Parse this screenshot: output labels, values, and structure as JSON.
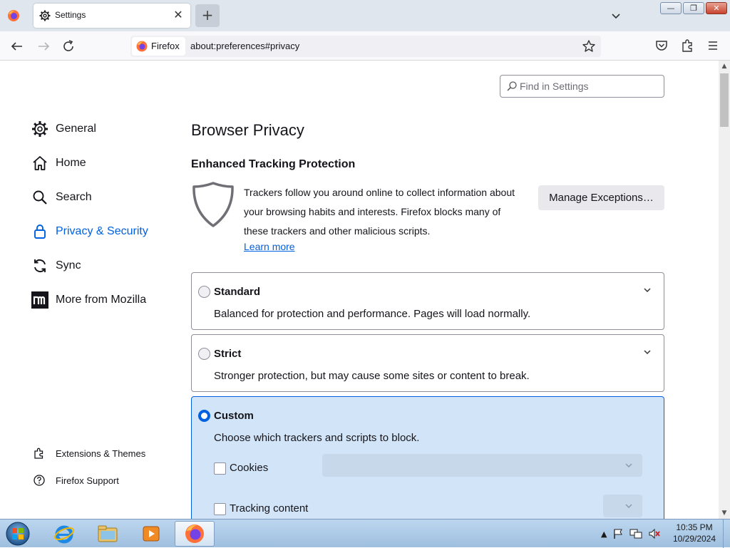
{
  "browser": {
    "tab_title": "Settings",
    "tab_close_glyph": "✕",
    "new_tab_glyph": "+",
    "identity_label": "Firefox",
    "url": "about:preferences#privacy"
  },
  "window_controls": {
    "minimize": "—",
    "maximize": "❐",
    "close": "✕"
  },
  "search": {
    "placeholder": "Find in Settings"
  },
  "sidebar": {
    "categories": [
      {
        "label": "General",
        "icon": "gear-icon"
      },
      {
        "label": "Home",
        "icon": "home-icon"
      },
      {
        "label": "Search",
        "icon": "search-icon"
      },
      {
        "label": "Privacy & Security",
        "icon": "lock-icon",
        "selected": true
      },
      {
        "label": "Sync",
        "icon": "sync-icon"
      },
      {
        "label": "More from Mozilla",
        "icon": "mozilla-icon"
      }
    ],
    "footer": [
      {
        "label": "Extensions & Themes",
        "icon": "puzzle-icon"
      },
      {
        "label": "Firefox Support",
        "icon": "help-icon"
      }
    ]
  },
  "page": {
    "heading": "Browser Privacy",
    "etp_heading": "Enhanced Tracking Protection",
    "etp_description": "Trackers follow you around online to collect information about your browsing habits and interests. Firefox blocks many of these trackers and other malicious scripts.",
    "learn_more": "Learn more",
    "manage_exceptions": "Manage Exceptions…",
    "options": [
      {
        "title": "Standard",
        "description": "Balanced for protection and performance. Pages will load normally.",
        "checked": false
      },
      {
        "title": "Strict",
        "description": "Stronger protection, but may cause some sites or content to break.",
        "checked": false
      },
      {
        "title": "Custom",
        "description": "Choose which trackers and scripts to block.",
        "checked": true
      }
    ],
    "custom_items": [
      {
        "label": "Cookies",
        "checked": false
      },
      {
        "label": "Tracking content",
        "checked": false
      }
    ]
  },
  "taskbar": {
    "apps": [
      "start-icon",
      "internet-explorer-icon",
      "file-explorer-icon",
      "media-player-icon",
      "firefox-icon"
    ],
    "tray_glyph": "▲",
    "time": "10:35 PM",
    "date": "10/29/2024"
  },
  "colors": {
    "accent": "#0061e0",
    "custom_card_bg": "#d2e5f8",
    "tabstrip_bg": "#dfe6ee"
  }
}
